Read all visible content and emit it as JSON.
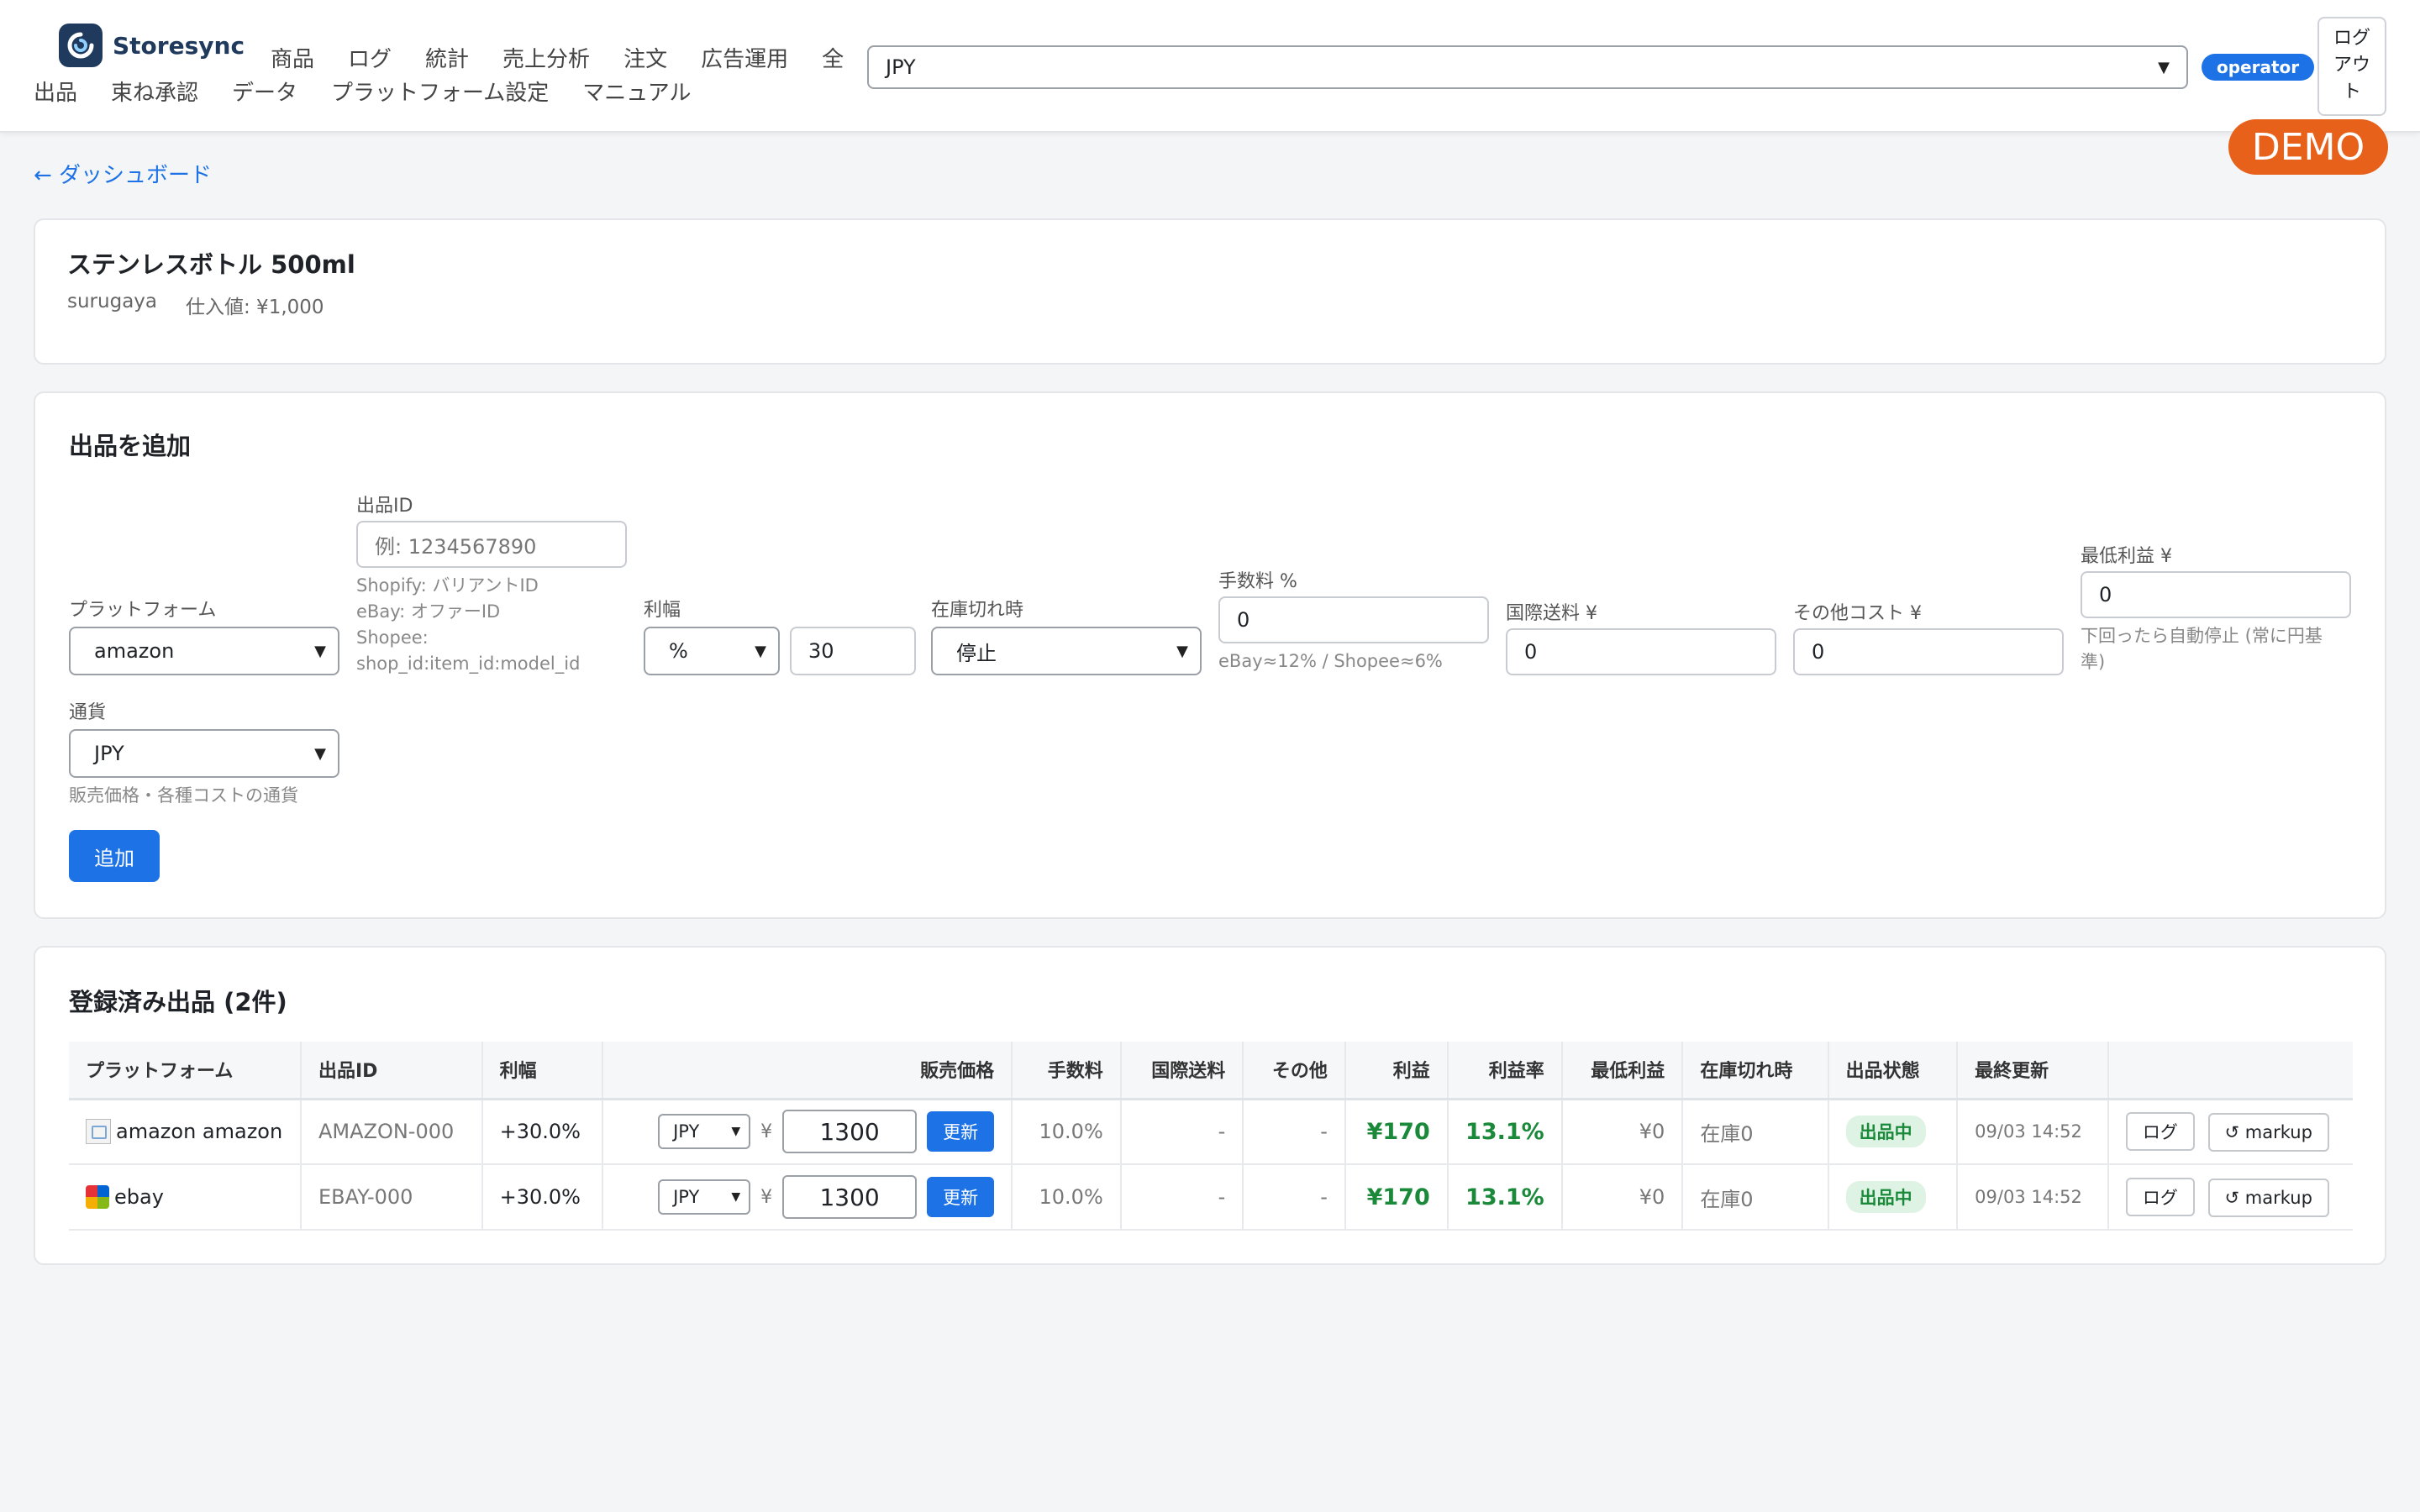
{
  "header": {
    "brand": "Storesync",
    "nav_row1": [
      "商品",
      "ログ",
      "統計",
      "売上分析",
      "注文",
      "広告運用",
      "全"
    ],
    "nav_row2": [
      "出品",
      "束ね承認",
      "データ",
      "プラットフォーム設定",
      "マニュアル"
    ],
    "currency": "JPY",
    "role": "operator",
    "logout_lines": [
      "ログ",
      "アウ",
      "ト"
    ],
    "demo": "DEMO"
  },
  "back_link": "← ダッシュボード",
  "product": {
    "title": "ステンレスボトル 500ml",
    "source": "surugaya",
    "cost": "仕入値: ¥1,000"
  },
  "add_form": {
    "heading": "出品を追加",
    "platform_label": "プラットフォーム",
    "platform_value": "amazon",
    "listing_id_label": "出品ID",
    "listing_id_placeholder": "例: 1234567890",
    "listing_id_hints": [
      "Shopify: バリアントID",
      "eBay: オファーID",
      "Shopee:",
      "shop_id:item_id:model_id"
    ],
    "margin_label": "利幅",
    "margin_type": "%",
    "margin_value": "30",
    "oos_label": "在庫切れ時",
    "oos_value": "停止",
    "fee_label": "手数料 %",
    "fee_value": "0",
    "fee_hint": "eBay≈12% / Shopee≈6%",
    "intl_shipping_label": "国際送料 ¥",
    "intl_shipping_value": "0",
    "other_cost_label": "その他コスト ¥",
    "other_cost_value": "0",
    "min_profit_label": "最低利益 ¥",
    "min_profit_value": "0",
    "min_profit_hint": [
      "下回ったら自動停止 (常に円基",
      "準)"
    ],
    "currency_label": "通貨",
    "currency_value": "JPY",
    "currency_hint": "販売価格・各種コストの通貨",
    "submit": "追加"
  },
  "listings": {
    "heading": "登録済み出品 (2件)",
    "columns": [
      "プラットフォーム",
      "出品ID",
      "利幅",
      "販売価格",
      "手数料",
      "国際送料",
      "その他",
      "利益",
      "利益率",
      "最低利益",
      "在庫切れ時",
      "出品状態",
      "最終更新",
      ""
    ],
    "rows": [
      {
        "platform": "amazon amazon",
        "id": "AMAZON-000",
        "margin": "+30.0%",
        "currency": "JPY",
        "yen": "¥",
        "price": "1300",
        "update": "更新",
        "fee": "10.0%",
        "intl": "-",
        "other": "-",
        "profit": "¥170",
        "rate": "13.1%",
        "min_profit": "¥0",
        "oos": "在庫0",
        "status": "出品中",
        "updated": "09/03 14:52",
        "log_btn": "ログ",
        "markup_btn": "↺ markup"
      },
      {
        "platform": "ebay",
        "id": "EBAY-000",
        "margin": "+30.0%",
        "currency": "JPY",
        "yen": "¥",
        "price": "1300",
        "update": "更新",
        "fee": "10.0%",
        "intl": "-",
        "other": "-",
        "profit": "¥170",
        "rate": "13.1%",
        "min_profit": "¥0",
        "oos": "在庫0",
        "status": "出品中",
        "updated": "09/03 14:52",
        "log_btn": "ログ",
        "markup_btn": "↺ markup"
      }
    ]
  },
  "colors": {
    "accent": "#1d73e6",
    "demo": "#e8611a",
    "profit_green": "#1a8a3a",
    "brand_dark": "#1f3a5c"
  }
}
